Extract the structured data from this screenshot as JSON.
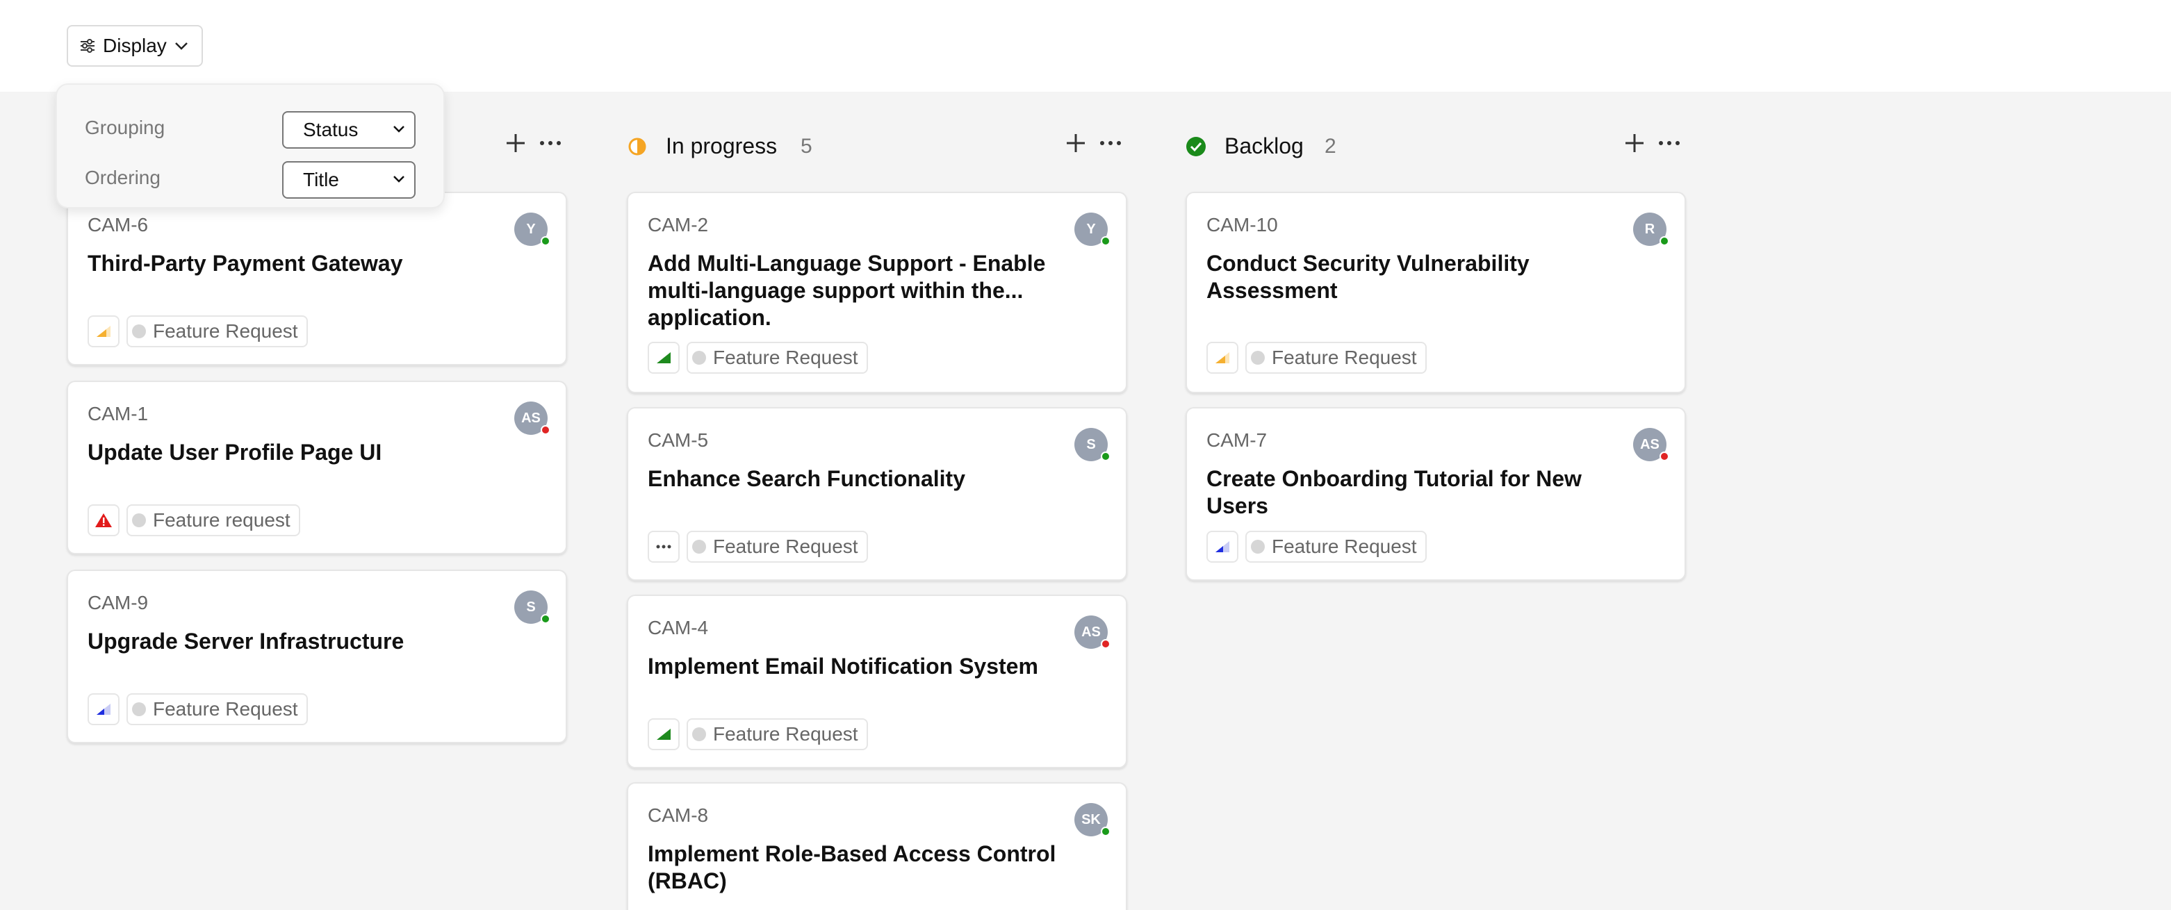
{
  "toolbar": {
    "display_label": "Display"
  },
  "display_menu": {
    "grouping_label": "Grouping",
    "grouping_value": "Status",
    "ordering_label": "Ordering",
    "ordering_value": "Title"
  },
  "columns": [
    {
      "title": "",
      "count": "",
      "cards": [
        {
          "id": "CAM-6",
          "title": "Third-Party Payment Gateway",
          "avatar": "Y",
          "presence": "online",
          "priority": "medium",
          "label": "Feature Request"
        },
        {
          "id": "CAM-1",
          "title": "Update User Profile Page UI",
          "avatar": "AS",
          "presence": "busy",
          "priority": "urgent",
          "label": "Feature request"
        },
        {
          "id": "CAM-9",
          "title": "Upgrade Server Infrastructure",
          "avatar": "S",
          "presence": "online",
          "priority": "low",
          "label": "Feature Request"
        }
      ]
    },
    {
      "title": "In progress",
      "count": "5",
      "status_icon": "half-circle-icon",
      "cards": [
        {
          "id": "CAM-2",
          "title": "Add Multi-Language Support - Enable multi-language support within the... application.",
          "avatar": "Y",
          "presence": "online",
          "priority": "high",
          "label": "Feature Request"
        },
        {
          "id": "CAM-5",
          "title": "Enhance Search Functionality",
          "avatar": "S",
          "presence": "online",
          "priority": "none",
          "label": "Feature Request"
        },
        {
          "id": "CAM-4",
          "title": "Implement Email Notification System",
          "avatar": "AS",
          "presence": "busy",
          "priority": "high",
          "label": "Feature Request"
        },
        {
          "id": "CAM-8",
          "title": "Implement Role-Based Access Control (RBAC)",
          "avatar": "SK",
          "presence": "online",
          "priority": "",
          "label": ""
        }
      ]
    },
    {
      "title": "Backlog",
      "count": "2",
      "status_icon": "check-circle-icon",
      "cards": [
        {
          "id": "CAM-10",
          "title": "Conduct Security Vulnerability Assessment",
          "avatar": "R",
          "presence": "online",
          "priority": "medium",
          "label": "Feature Request"
        },
        {
          "id": "CAM-7",
          "title": "Create Onboarding Tutorial for New Users",
          "avatar": "AS",
          "presence": "busy",
          "priority": "low",
          "label": "Feature Request"
        }
      ]
    }
  ],
  "colors": {
    "online": "#1a9a1a",
    "busy": "#e02424",
    "in_progress": "#f5a524",
    "backlog": "#1a8a1a",
    "priority_high": "#1e8a1e",
    "priority_medium": "#f5b030",
    "priority_low": "#1f2ee0",
    "priority_urgent": "#e21b1b"
  }
}
